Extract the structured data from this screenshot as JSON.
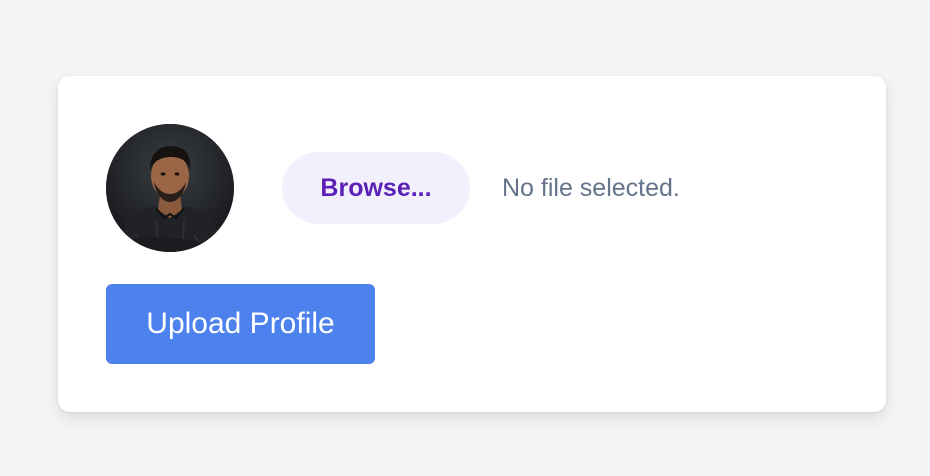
{
  "avatar": {
    "icon": "profile-photo"
  },
  "file_input": {
    "browse_label": "Browse...",
    "status_text": "No file selected."
  },
  "actions": {
    "upload_label": "Upload Profile"
  },
  "colors": {
    "page_background": "#f3f4f6",
    "card_background": "#ffffff",
    "browse_background": "#f3f0fd",
    "browse_text": "#5b21b6",
    "status_text": "#64748b",
    "upload_background": "#4d82ee",
    "upload_text": "#ffffff"
  }
}
